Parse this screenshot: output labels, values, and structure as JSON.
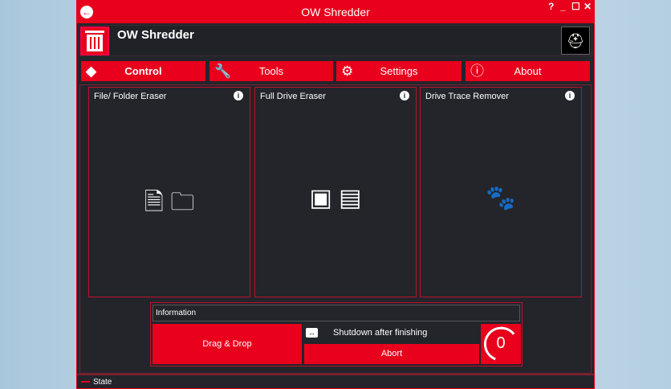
{
  "window": {
    "title": "OW Shredder",
    "help": "?",
    "minimize": "_",
    "maximize": "☐",
    "close": "✕"
  },
  "header": {
    "app_name": "OW Shredder"
  },
  "nav": [
    {
      "label": "Control",
      "icon": "eraser-icon"
    },
    {
      "label": "Tools",
      "icon": "tools-icon"
    },
    {
      "label": "Settings",
      "icon": "gear-icon"
    },
    {
      "label": "About",
      "icon": "info-message-icon"
    }
  ],
  "panels": [
    {
      "title": "File/ Folder Eraser"
    },
    {
      "title": "Full Drive Eraser"
    },
    {
      "title": "Drive Trace Remover"
    }
  ],
  "info": {
    "title": "Information",
    "drag_drop": "Drag & Drop",
    "shutdown": "Shutdown after finishing",
    "abort": "Abort",
    "counter": "0"
  },
  "status": {
    "label": "State"
  },
  "colors": {
    "accent": "#e8001c",
    "background": "#23252b"
  }
}
